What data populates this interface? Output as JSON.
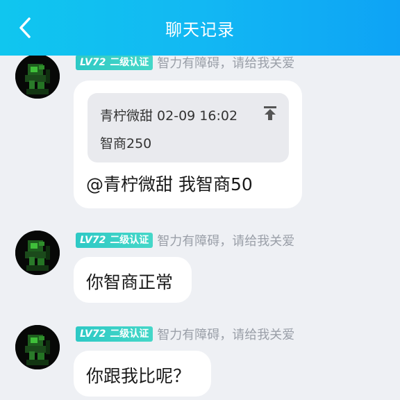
{
  "header": {
    "title": "聊天记录",
    "back_icon": "chevron-left-icon"
  },
  "messages": [
    {
      "level": "LV72",
      "rank": "二级认证",
      "signature": "智力有障碍，请给我关爱",
      "quote": {
        "author_time": "青柠微甜 02-09 16:02",
        "text": "智商250",
        "icon": "pin-to-top-icon"
      },
      "text": "@青柠微甜 我智商50"
    },
    {
      "level": "LV72",
      "rank": "二级认证",
      "signature": "智力有障碍，请给我关爱",
      "text": "你智商正常"
    },
    {
      "level": "LV72",
      "rank": "二级认证",
      "signature": "智力有障碍，请给我关爱",
      "text": "你跟我比呢？"
    }
  ],
  "colors": {
    "header_start": "#10c6ef",
    "header_end": "#0ea3f5",
    "badge": "#2ec9c5",
    "background": "#eef0f4"
  }
}
